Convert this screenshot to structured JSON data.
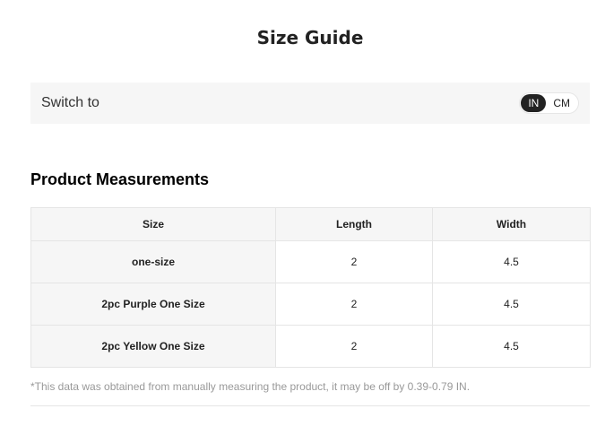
{
  "title": "Size Guide",
  "switch": {
    "label": "Switch to",
    "options": [
      "IN",
      "CM"
    ],
    "selected": "IN"
  },
  "section_title": "Product Measurements",
  "table": {
    "headers": [
      "Size",
      "Length",
      "Width"
    ],
    "rows": [
      [
        "one-size",
        "2",
        "4.5"
      ],
      [
        "2pc Purple One Size",
        "2",
        "4.5"
      ],
      [
        "2pc Yellow One Size",
        "2",
        "4.5"
      ]
    ]
  },
  "note": "*This data was obtained from manually measuring the product, it may be off by 0.39-0.79 IN.",
  "colors": {
    "bar_background": "#f6f6f6",
    "toggle_active": "#222222",
    "border": "#e5e5e5",
    "note_text": "#999999"
  }
}
